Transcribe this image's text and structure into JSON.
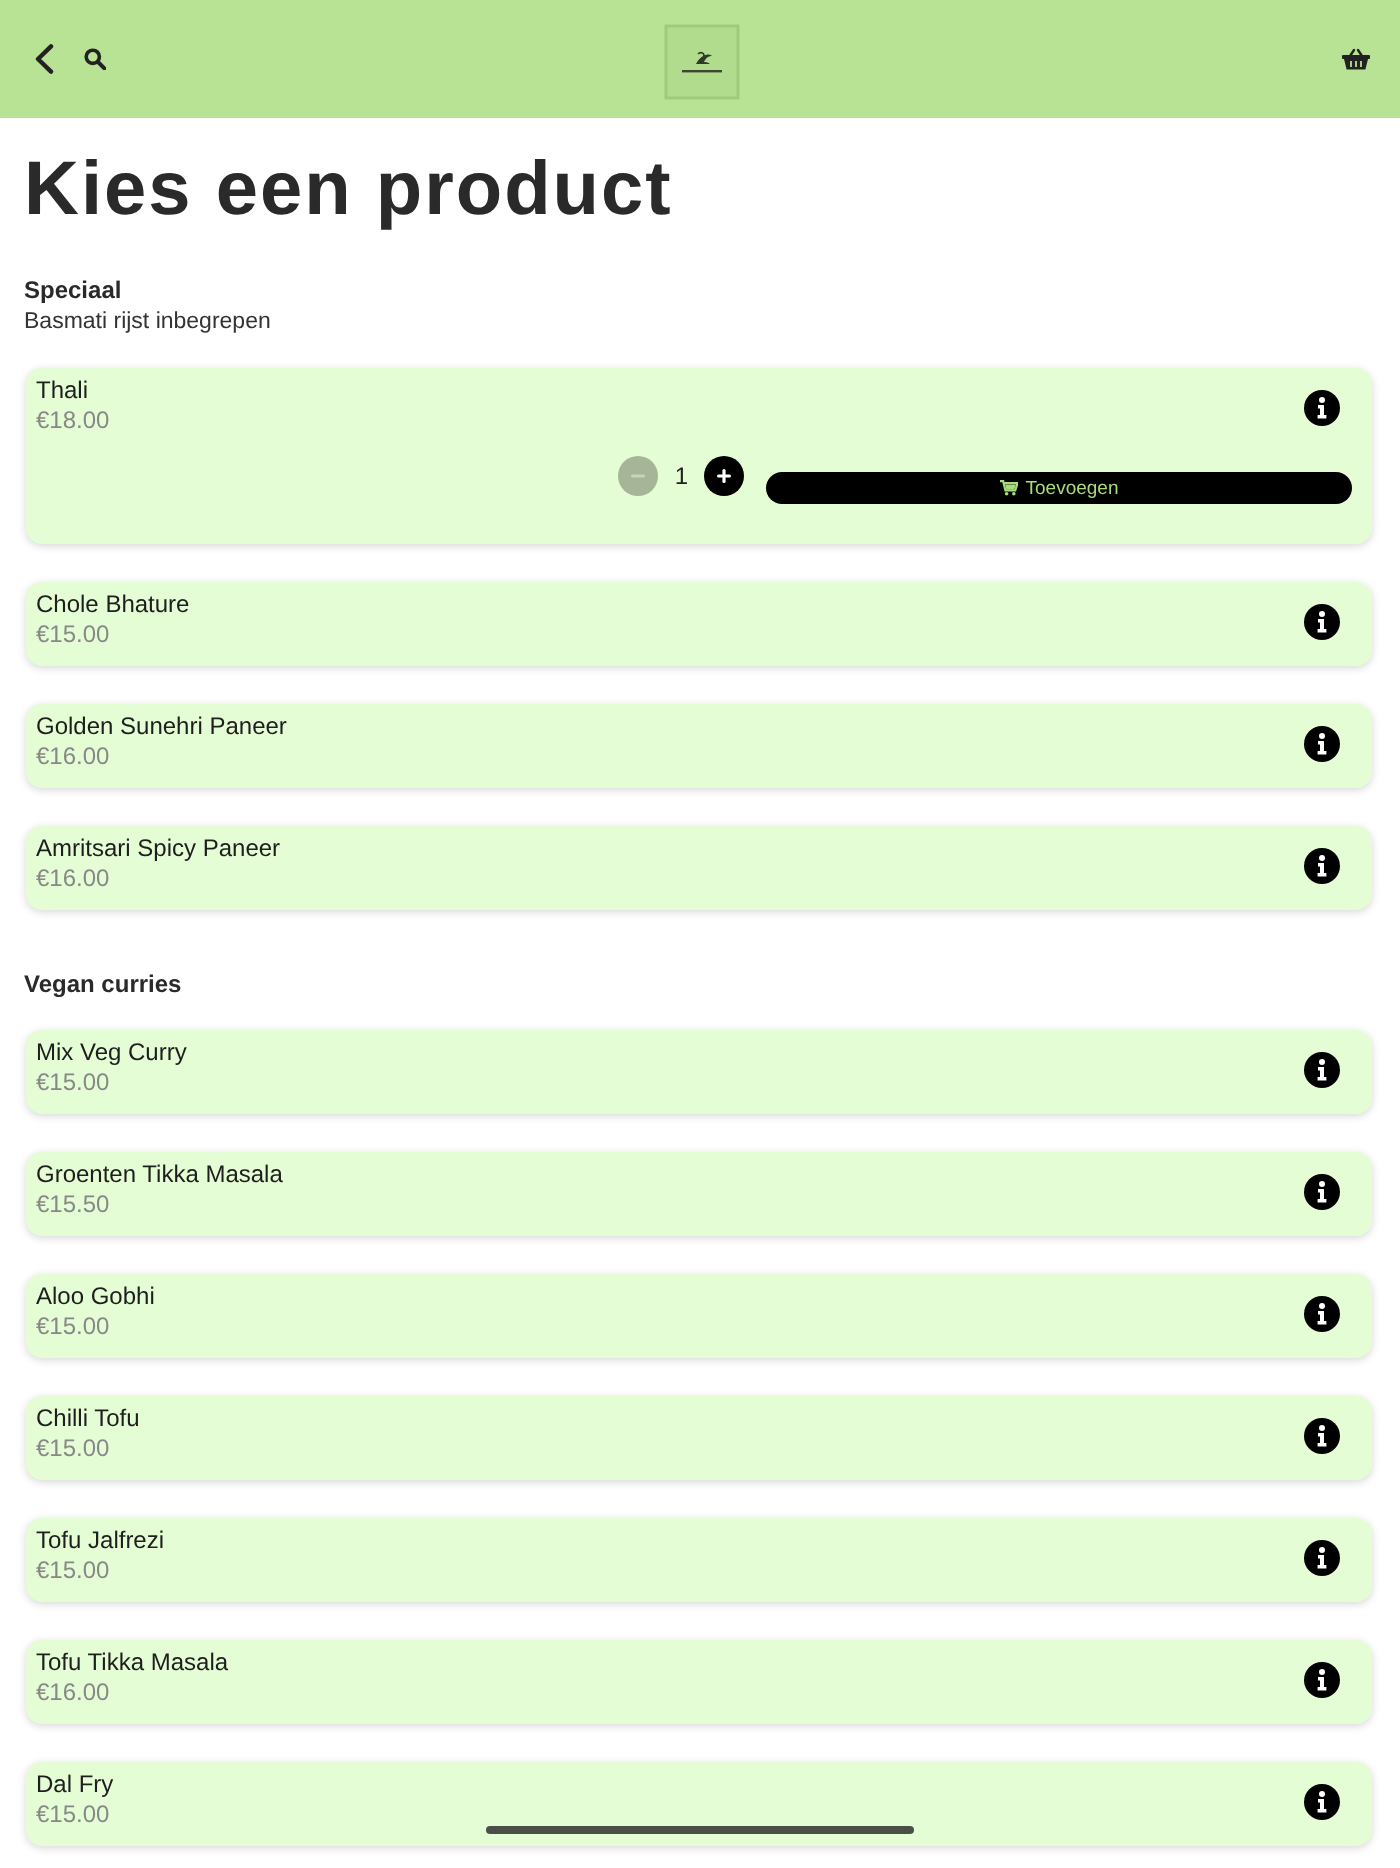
{
  "title": "Kies een product",
  "sections": [
    {
      "title": "Speciaal",
      "subtitle": "Basmati rijst inbegrepen",
      "products": [
        {
          "name": "Thali",
          "price": "€18.00",
          "expanded": true,
          "quantity": "1",
          "decrease_disabled": true,
          "add_label": "Toevoegen"
        },
        {
          "name": "Chole Bhature",
          "price": "€15.00",
          "expanded": false
        },
        {
          "name": "Golden Sunehri Paneer",
          "price": "€16.00",
          "expanded": false
        },
        {
          "name": "Amritsari Spicy Paneer",
          "price": "€16.00",
          "expanded": false
        }
      ]
    },
    {
      "title": "Vegan curries",
      "products": [
        {
          "name": "Mix Veg Curry",
          "price": "€15.00",
          "expanded": false
        },
        {
          "name": "Groenten Tikka Masala",
          "price": "€15.50",
          "expanded": false
        },
        {
          "name": "Aloo Gobhi",
          "price": "€15.00",
          "expanded": false
        },
        {
          "name": "Chilli Tofu",
          "price": "€15.00",
          "expanded": false
        },
        {
          "name": "Tofu Jalfrezi",
          "price": "€15.00",
          "expanded": false
        },
        {
          "name": "Tofu Tikka Masala",
          "price": "€16.00",
          "expanded": false
        },
        {
          "name": "Dal Fry",
          "price": "€15.00",
          "expanded": false
        }
      ]
    }
  ]
}
